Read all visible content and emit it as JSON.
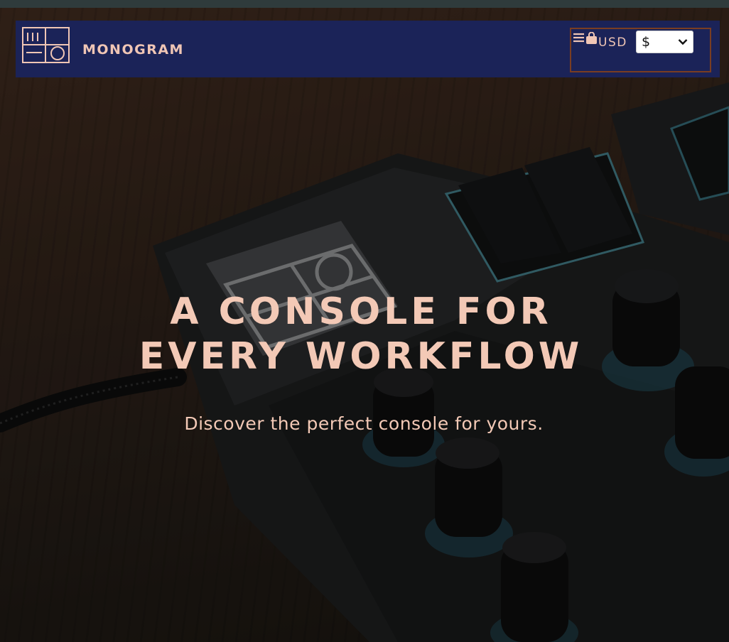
{
  "header": {
    "brand": "MONOGRAM",
    "currency_label": "USD",
    "currency_selected": "$",
    "icons": [
      "logo-mark",
      "menu-icon",
      "shopping-bag-icon",
      "chevron-down-icon"
    ]
  },
  "hero": {
    "headline_line1": "A CONSOLE FOR",
    "headline_line2": "EVERY WORKFLOW",
    "tagline": "Discover the perfect console for yours."
  },
  "colors": {
    "navbar_bg": "#1b2358",
    "accent_text": "#f3c9b6",
    "controls_border": "#7a3d22",
    "top_strip": "#2f3b3c"
  }
}
